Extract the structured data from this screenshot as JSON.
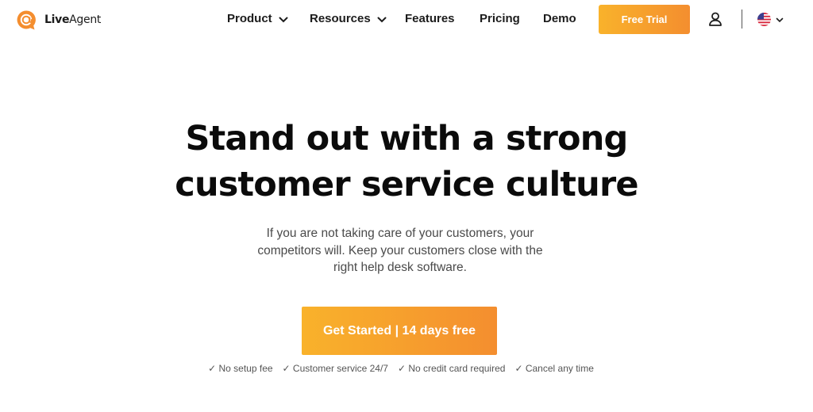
{
  "header": {
    "logo": {
      "brand_part1": "Live",
      "brand_part2": "Agent",
      "icon": "liveagent-logo-icon",
      "accent_color": "#f48e2f"
    },
    "nav": {
      "product": "Product",
      "resources": "Resources",
      "features": "Features",
      "pricing": "Pricing",
      "demo": "Demo"
    },
    "free_trial_label": "Free Trial",
    "account_icon": "user-icon",
    "language_icon": "us-flag-icon"
  },
  "hero": {
    "title_line1": "Stand out with a strong",
    "title_line2": "customer service culture",
    "subtitle_line1": "If you are not taking care of your customers, your",
    "subtitle_line2": "competitors will. Keep your customers close with the",
    "subtitle_line3": "right help desk software.",
    "cta_label": "Get Started | 14 days free",
    "cta_gradient": [
      "#f9b22b",
      "#f48e2f"
    ],
    "benefits": [
      "✓ No setup fee",
      "✓ Customer service 24/7",
      "✓ No credit card required",
      "✓ Cancel any time"
    ]
  }
}
